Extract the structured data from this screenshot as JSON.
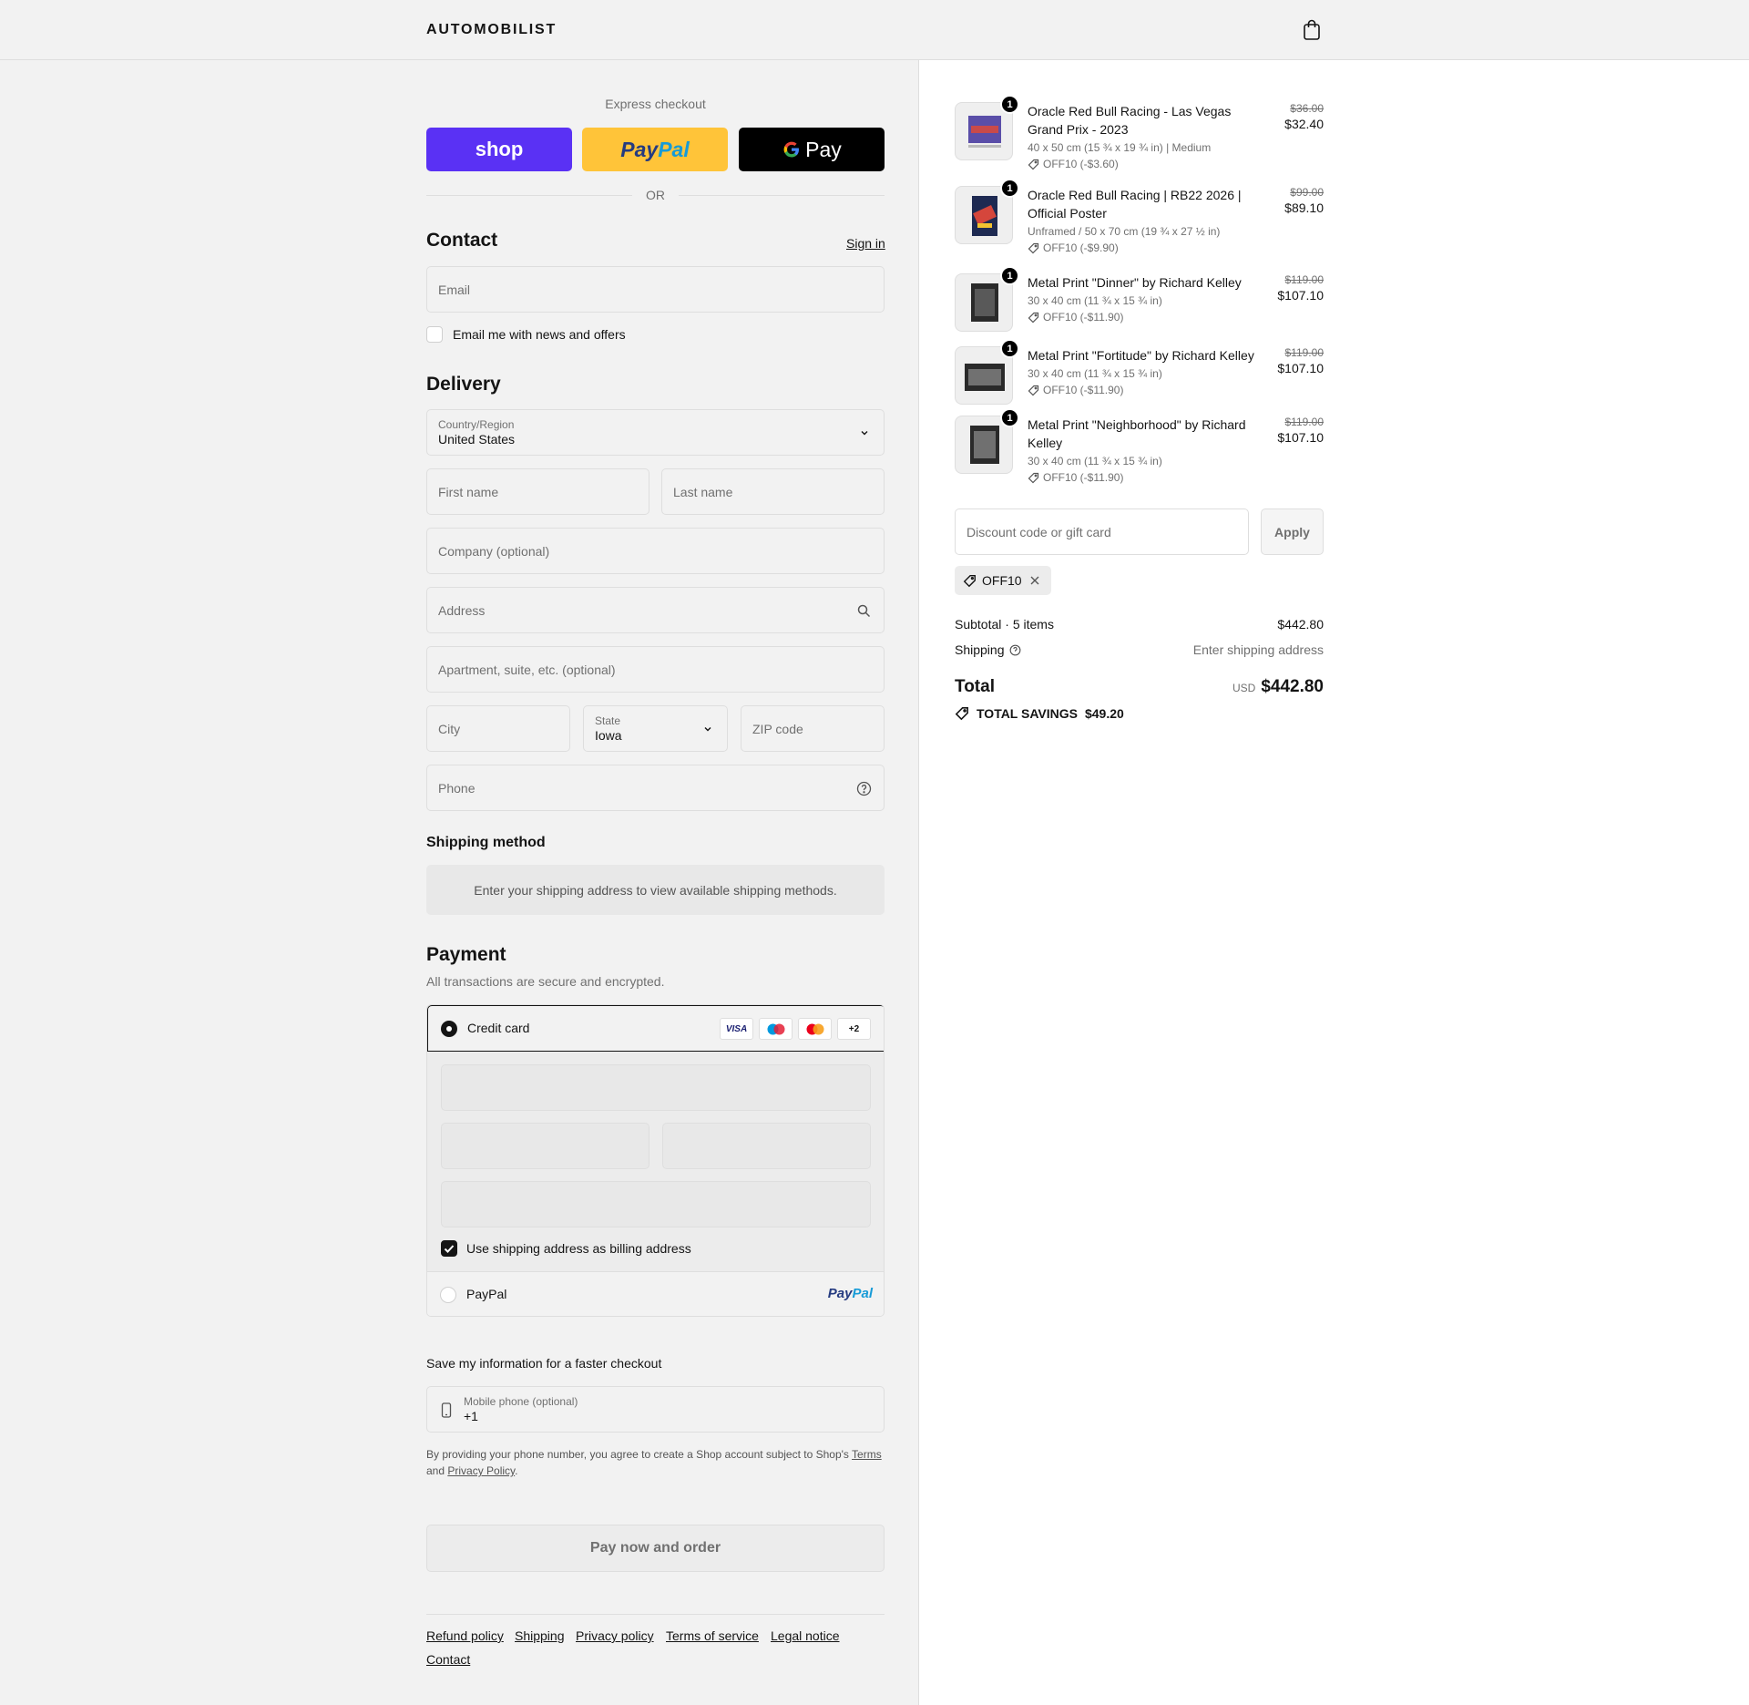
{
  "header": {
    "logo": "AUTOMOBILIST",
    "cart_icon": "shopping-bag-icon"
  },
  "express": {
    "title": "Express checkout",
    "shop_label": "shop",
    "paypal_label_a": "Pay",
    "paypal_label_b": "Pal",
    "gpay_label": "Pay",
    "or_label": "OR"
  },
  "contact": {
    "title": "Contact",
    "sign_in": "Sign in",
    "email_placeholder": "Email",
    "newsletter_label": "Email me with news and offers"
  },
  "delivery": {
    "title": "Delivery",
    "country_label": "Country/Region",
    "country_value": "United States",
    "first_name": "First name",
    "last_name": "Last name",
    "company": "Company (optional)",
    "address": "Address",
    "apartment": "Apartment, suite, etc. (optional)",
    "city": "City",
    "state_label": "State",
    "state_value": "Iowa",
    "zip": "ZIP code",
    "phone": "Phone"
  },
  "shipping_method": {
    "title": "Shipping method",
    "message": "Enter your shipping address to view available shipping methods."
  },
  "payment": {
    "title": "Payment",
    "subtitle": "All transactions are secure and encrypted.",
    "credit_card_label": "Credit card",
    "visa": "VISA",
    "more_cards": "+2",
    "billing_label": "Use shipping address as billing address",
    "paypal_label": "PayPal",
    "paypal_logo_a": "Pay",
    "paypal_logo_b": "Pal"
  },
  "save_info": {
    "title": "Save my information for a faster checkout",
    "mobile_label": "Mobile phone (optional)",
    "mobile_value": "+1",
    "legal_a": "By providing your phone number, you agree to create a Shop account subject to Shop's ",
    "terms": "Terms",
    "legal_b": "and ",
    "privacy": "Privacy Policy",
    "legal_c": "."
  },
  "pay_button": "Pay now and order",
  "footer": {
    "refund": "Refund policy",
    "shipping": "Shipping",
    "privacy": "Privacy policy",
    "terms": "Terms of service",
    "legal": "Legal notice",
    "contact": "Contact"
  },
  "order": {
    "items": [
      {
        "qty": "1",
        "name": "Oracle Red Bull Racing - Las Vegas Grand Prix - 2023",
        "variant": "40 x 50 cm (15 ¾ x 19 ¾ in) | Medium",
        "discount": "OFF10 (-$3.60)",
        "old_price": "$36.00",
        "price": "$32.40"
      },
      {
        "qty": "1",
        "name": "Oracle Red Bull Racing | RB22 2026 | Official Poster",
        "variant": "Unframed / 50 x 70 cm (19 ¾ x 27 ½ in)",
        "discount": "OFF10 (-$9.90)",
        "old_price": "$99.00",
        "price": "$89.10"
      },
      {
        "qty": "1",
        "name": "Metal Print \"Dinner\" by Richard Kelley",
        "variant": "30 x 40 cm (11 ¾ x 15 ¾ in)",
        "discount": "OFF10 (-$11.90)",
        "old_price": "$119.00",
        "price": "$107.10"
      },
      {
        "qty": "1",
        "name": "Metal Print \"Fortitude\" by Richard Kelley",
        "variant": "30 x 40 cm (11 ¾ x 15 ¾ in)",
        "discount": "OFF10 (-$11.90)",
        "old_price": "$119.00",
        "price": "$107.10"
      },
      {
        "qty": "1",
        "name": "Metal Print \"Neighborhood\" by Richard Kelley",
        "variant": "30 x 40 cm (11 ¾ x 15 ¾ in)",
        "discount": "OFF10 (-$11.90)",
        "old_price": "$119.00",
        "price": "$107.10"
      }
    ],
    "discount_placeholder": "Discount code or gift card",
    "apply": "Apply",
    "applied_code": "OFF10",
    "subtotal_label": "Subtotal · 5 items",
    "subtotal_value": "$442.80",
    "shipping_label": "Shipping",
    "shipping_value": "Enter shipping address",
    "total_label": "Total",
    "currency": "USD",
    "total_value": "$442.80",
    "savings_label": "TOTAL SAVINGS",
    "savings_value": "$49.20"
  },
  "colors": {
    "shop": "#5a31f4",
    "paypal": "#ffc439",
    "gpay": "#000000",
    "text": "#141414",
    "muted": "#707070",
    "border": "#dedede",
    "panel": "#f2f2f2"
  }
}
